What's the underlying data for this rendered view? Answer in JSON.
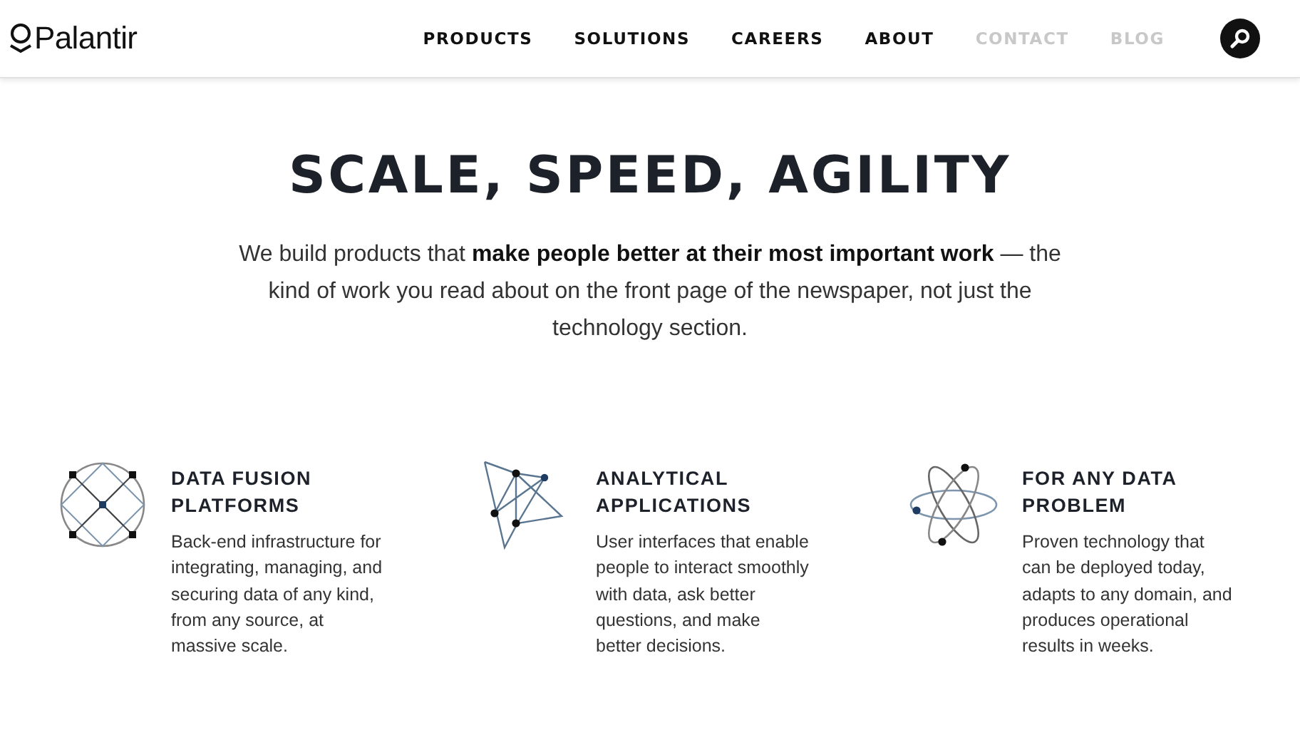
{
  "header": {
    "logo": "Palantir",
    "nav": [
      {
        "label": "PRODUCTS",
        "dimmed": false
      },
      {
        "label": "SOLUTIONS",
        "dimmed": false
      },
      {
        "label": "CAREERS",
        "dimmed": false
      },
      {
        "label": "ABOUT",
        "dimmed": false
      },
      {
        "label": "CONTACT",
        "dimmed": true
      },
      {
        "label": "BLOG",
        "dimmed": true
      }
    ]
  },
  "hero": {
    "title": "SCALE, SPEED, AGILITY",
    "text": "We build products that **make people better at their most important work** — the kind of work you read about on the front page of the newspaper, not just the technology section."
  },
  "features": [
    {
      "kind": "grid",
      "title": "DATA FUSION PLATFORMS",
      "text": "Back-end infrastructure for integrating, managing, and securing data of any kind, from any source, at massive scale."
    },
    {
      "kind": "network",
      "title": "ANALYTICAL APPLICATIONS",
      "text": "User interfaces that enable people to interact smoothly with data, ask better questions, and make better decisions."
    },
    {
      "kind": "atom",
      "title": "FOR ANY DATA PROBLEM",
      "text": "Proven technology that can be deployed today, adapts to any domain, and produces operational results in weeks."
    }
  ]
}
